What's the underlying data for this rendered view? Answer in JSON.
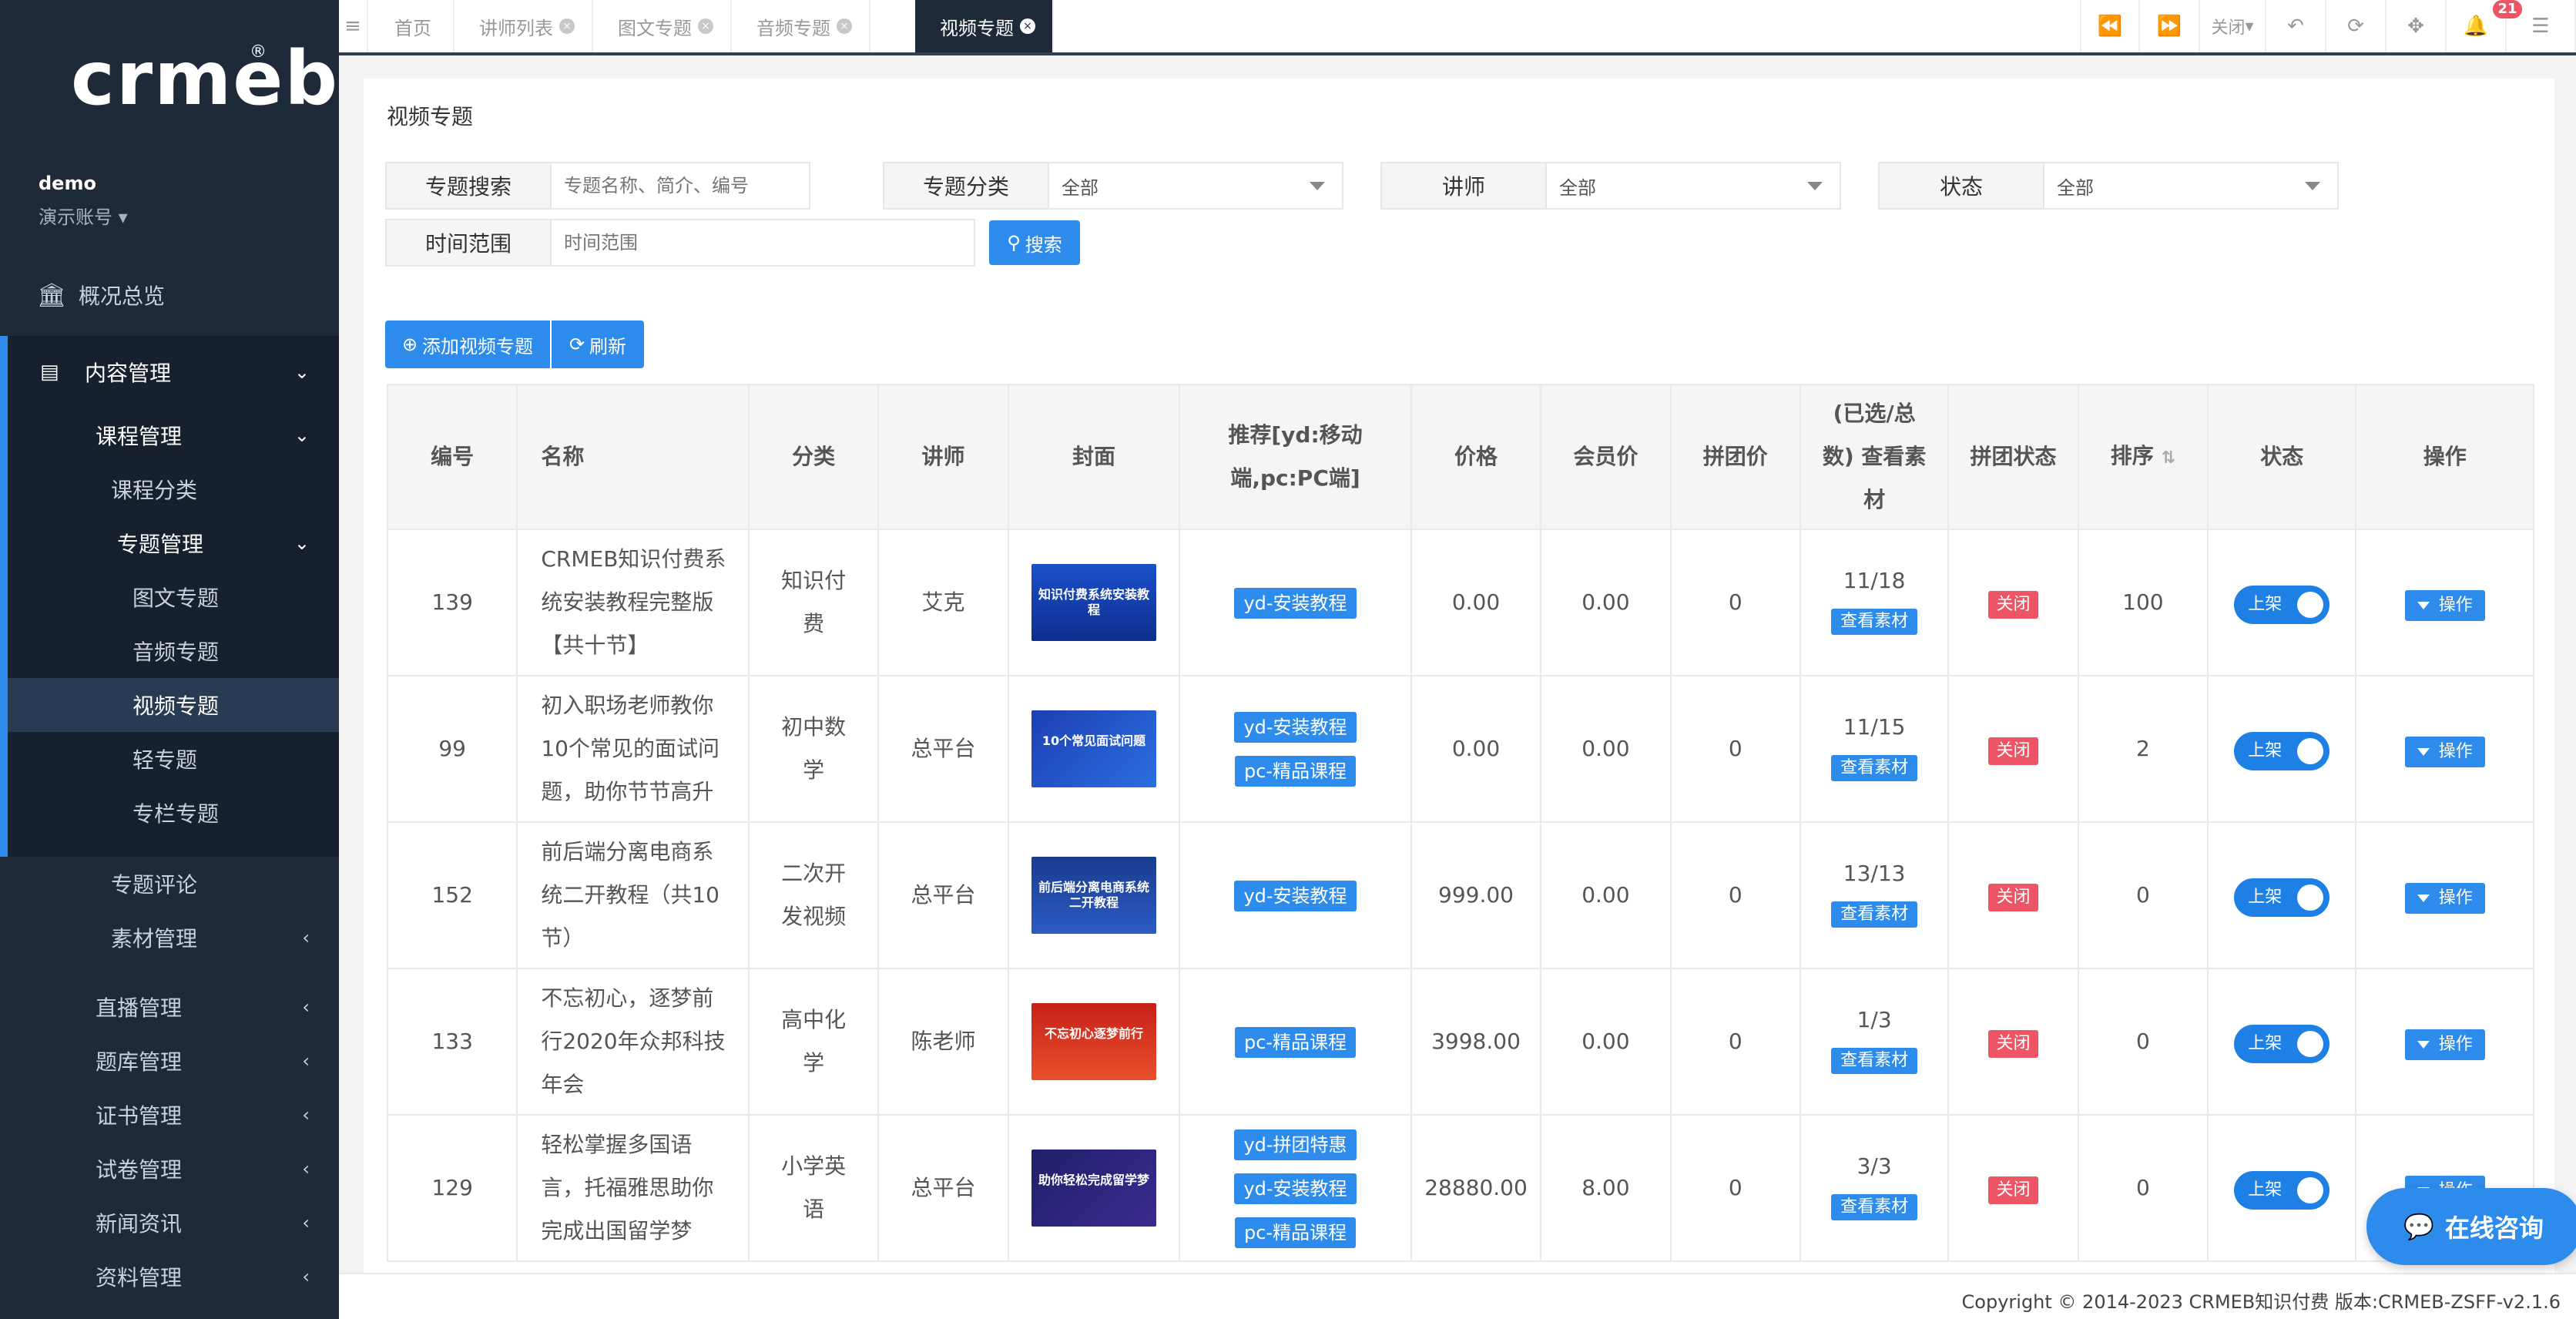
{
  "sidebar": {
    "logo": "crmeb",
    "user_name": "demo",
    "user_role": "演示账号",
    "items": [
      {
        "label": "概况总览"
      },
      {
        "label": "内容管理"
      },
      {
        "label": "课程管理"
      },
      {
        "label": "课程分类"
      },
      {
        "label": "专题管理"
      },
      {
        "label": "图文专题"
      },
      {
        "label": "音频专题"
      },
      {
        "label": "视频专题"
      },
      {
        "label": "轻专题"
      },
      {
        "label": "专栏专题"
      },
      {
        "label": "专题评论"
      },
      {
        "label": "素材管理"
      },
      {
        "label": "直播管理"
      },
      {
        "label": "题库管理"
      },
      {
        "label": "证书管理"
      },
      {
        "label": "试卷管理"
      },
      {
        "label": "新闻资讯"
      },
      {
        "label": "资料管理"
      }
    ]
  },
  "tabs": [
    {
      "label": "首页"
    },
    {
      "label": "讲师列表"
    },
    {
      "label": "图文专题"
    },
    {
      "label": "音频专题"
    },
    {
      "label": "视频专题"
    }
  ],
  "toolbar": {
    "close_label": "关闭",
    "notification_count": "21"
  },
  "panel": {
    "title": "视频专题"
  },
  "filters": {
    "search_label": "专题搜索",
    "search_placeholder": "专题名称、简介、编号",
    "category_label": "专题分类",
    "category_value": "全部",
    "teacher_label": "讲师",
    "teacher_value": "全部",
    "status_label": "状态",
    "status_value": "全部",
    "time_label": "时间范围",
    "time_placeholder": "时间范围",
    "search_button": "搜索"
  },
  "actions": {
    "add_label": "添加视频专题",
    "refresh_label": "刷新"
  },
  "table": {
    "headers": [
      "编号",
      "名称",
      "分类",
      "讲师",
      "封面",
      "推荐[yd:移动端,pc:PC端]",
      "价格",
      "会员价",
      "拼团价",
      "(已选/总数) 查看素材",
      "拼团状态",
      "排序",
      "状态",
      "操作"
    ],
    "material_label": "查看素材",
    "group_status_label": "关闭",
    "status_switch_label": "上架",
    "op_label": "操作",
    "rows": [
      {
        "id": "139",
        "name": "CRMEB知识付费系统安装教程完整版【共十节】",
        "category": "知识付费",
        "teacher": "艾克",
        "cover_text": "知识付费系统安装教程",
        "tags": [
          "yd-安装教程"
        ],
        "price": "0.00",
        "vip_price": "0.00",
        "group_price": "0",
        "materials": "11/18",
        "sort": "100"
      },
      {
        "id": "99",
        "name": "初入职场老师教你10个常见的面试问题，助你节节高升",
        "category": "初中数学",
        "teacher": "总平台",
        "cover_text": "10个常见面试问题",
        "tags": [
          "yd-安装教程",
          "pc-精品课程"
        ],
        "price": "0.00",
        "vip_price": "0.00",
        "group_price": "0",
        "materials": "11/15",
        "sort": "2"
      },
      {
        "id": "152",
        "name": "前后端分离电商系统二开教程（共10节）",
        "category": "二次开发视频",
        "teacher": "总平台",
        "cover_text": "前后端分离电商系统二开教程",
        "tags": [
          "yd-安装教程"
        ],
        "price": "999.00",
        "vip_price": "0.00",
        "group_price": "0",
        "materials": "13/13",
        "sort": "0"
      },
      {
        "id": "133",
        "name": "不忘初心，逐梦前行2020年众邦科技年会",
        "category": "高中化学",
        "teacher": "陈老师",
        "cover_text": "不忘初心逐梦前行",
        "tags": [
          "pc-精品课程"
        ],
        "price": "3998.00",
        "vip_price": "0.00",
        "group_price": "0",
        "materials": "1/3",
        "sort": "0"
      },
      {
        "id": "129",
        "name": "轻松掌握多国语言，托福雅思助你完成出国留学梦",
        "category": "小学英语",
        "teacher": "总平台",
        "cover_text": "助你轻松完成留学梦",
        "tags": [
          "yd-拼团特惠",
          "yd-安装教程",
          "pc-精品课程"
        ],
        "price": "28880.00",
        "vip_price": "8.00",
        "group_price": "0",
        "materials": "3/3",
        "sort": "0"
      }
    ]
  },
  "footer": {
    "copyright": "Copyright © 2014-2023 CRMEB知识付费 版本:CRMEB-ZSFF-v2.1.6"
  },
  "consult": {
    "label": "在线咨询"
  }
}
